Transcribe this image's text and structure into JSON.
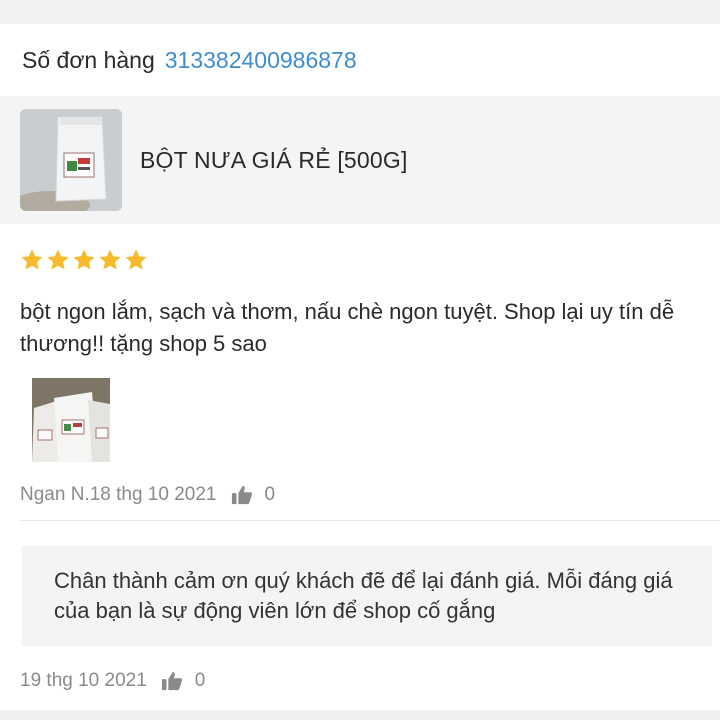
{
  "order": {
    "label": "Số đơn hàng",
    "number": "313382400986878"
  },
  "product": {
    "thumbnail_icon": "product-bag-photo",
    "title": "BỘT NƯA GIÁ RẺ [500G]"
  },
  "review": {
    "rating": 5,
    "rating_max": 5,
    "star_color": "#f6bb2c",
    "text": "bột ngon lắm, sạch và thơm, nấu chè ngon tuyệt. Shop lại uy tín dễ thương!! tặng shop 5 sao",
    "photo_icon": "review-photo",
    "author_date": "Ngan N.18 thg 10 2021",
    "like_count": "0"
  },
  "reply": {
    "text": "Chân thành cảm ơn quý khách đẽ để lại đánh giá. Mỗi đáng giá của bạn là sự động viên lớn để shop cố gắng",
    "date": "19 thg 10 2021",
    "like_count": "0"
  },
  "colors": {
    "link": "#3d8dd0",
    "muted": "#8a8a8a"
  }
}
